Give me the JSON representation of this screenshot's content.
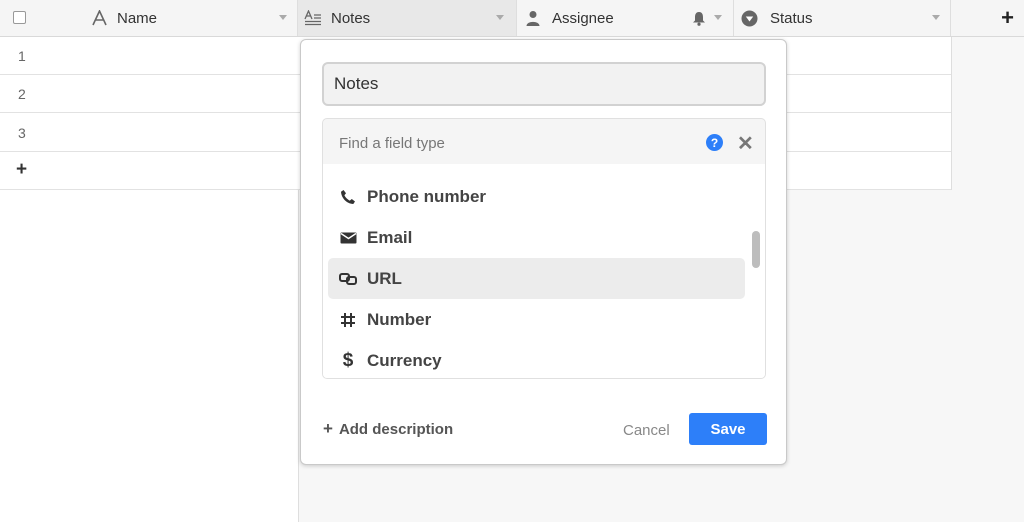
{
  "header": {
    "columns": [
      {
        "label": "Name",
        "icon": "text-icon"
      },
      {
        "label": "Notes",
        "icon": "long-text-icon"
      },
      {
        "label": "Assignee",
        "icon": "person-icon"
      },
      {
        "label": "Status",
        "icon": "status-icon"
      }
    ],
    "add_column": "+"
  },
  "rows": [
    {
      "num": "1"
    },
    {
      "num": "2"
    },
    {
      "num": "3"
    }
  ],
  "add_row": "+",
  "dialog": {
    "field_name": "Notes",
    "type_search_placeholder": "Find a field type",
    "help_glyph": "?",
    "close_glyph": "✕",
    "types": [
      {
        "label": "Phone number",
        "icon": "phone-icon",
        "selected": false
      },
      {
        "label": "Email",
        "icon": "email-icon",
        "selected": false
      },
      {
        "label": "URL",
        "icon": "link-icon",
        "selected": true
      },
      {
        "label": "Number",
        "icon": "hash-icon",
        "selected": false
      },
      {
        "label": "Currency",
        "icon": "dollar-icon",
        "selected": false
      }
    ],
    "add_description": "Add description",
    "add_description_glyph": "+",
    "cancel": "Cancel",
    "save": "Save",
    "accent_color": "#2d7ff9"
  }
}
